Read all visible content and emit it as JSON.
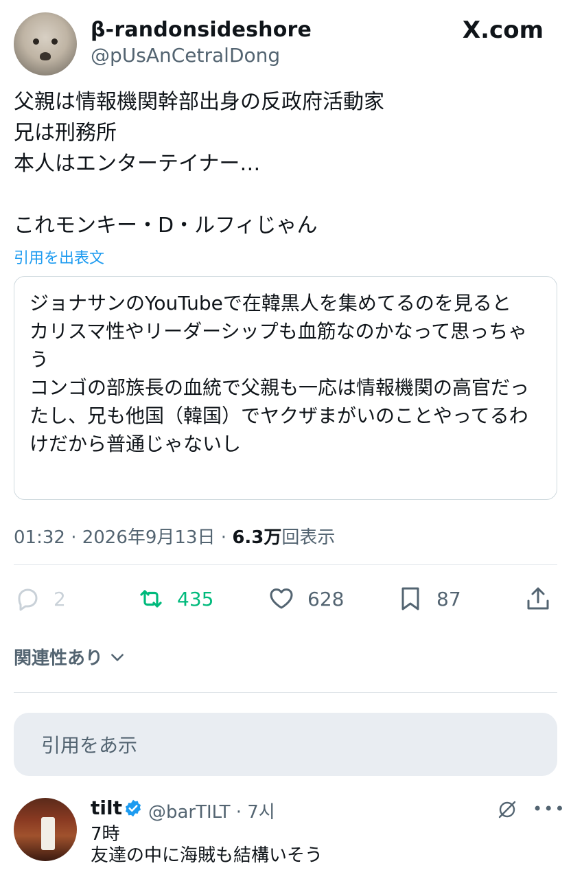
{
  "post": {
    "display_name": "β-randonsideshore",
    "handle": "@pUsAnCetralDong",
    "brand": "X.com",
    "text": "父親は情報機関幹部出身の反政府活動家\n兄は刑務所\n本人はエンターテイナー…\n\nこれモンキー・D・ルフィじゃん",
    "quote_label": "引用を出表文",
    "quote_text": "ジョナサンのYouTubeで在韓黒人を集めてるのを見ると\nカリスマ性やリーダーシップも血筋なのかなって思っちゃう\nコンゴの部族長の血統で父親も一応は情報機関の高官だったし、兄も他国（韓国）でヤクザまがいのことやってるわけだから普通じゃないし",
    "time": "01:32 · 2026年9月13日 · ",
    "views_count": "6.3万",
    "views_label": "回表示"
  },
  "actions": {
    "replies": "2",
    "retweets": "435",
    "likes": "628",
    "bookmarks": "87"
  },
  "colors": {
    "retweet_green": "#00ba7c",
    "link_blue": "#1d9bf0",
    "muted": "#536471"
  },
  "related_label": "関連性あり",
  "reply_box_placeholder": "引用をあ示",
  "reply": {
    "name": "tilt",
    "handle_time": "@barTILT · 7시",
    "text": "7時\n友達の中に海賊も結構いそう"
  }
}
